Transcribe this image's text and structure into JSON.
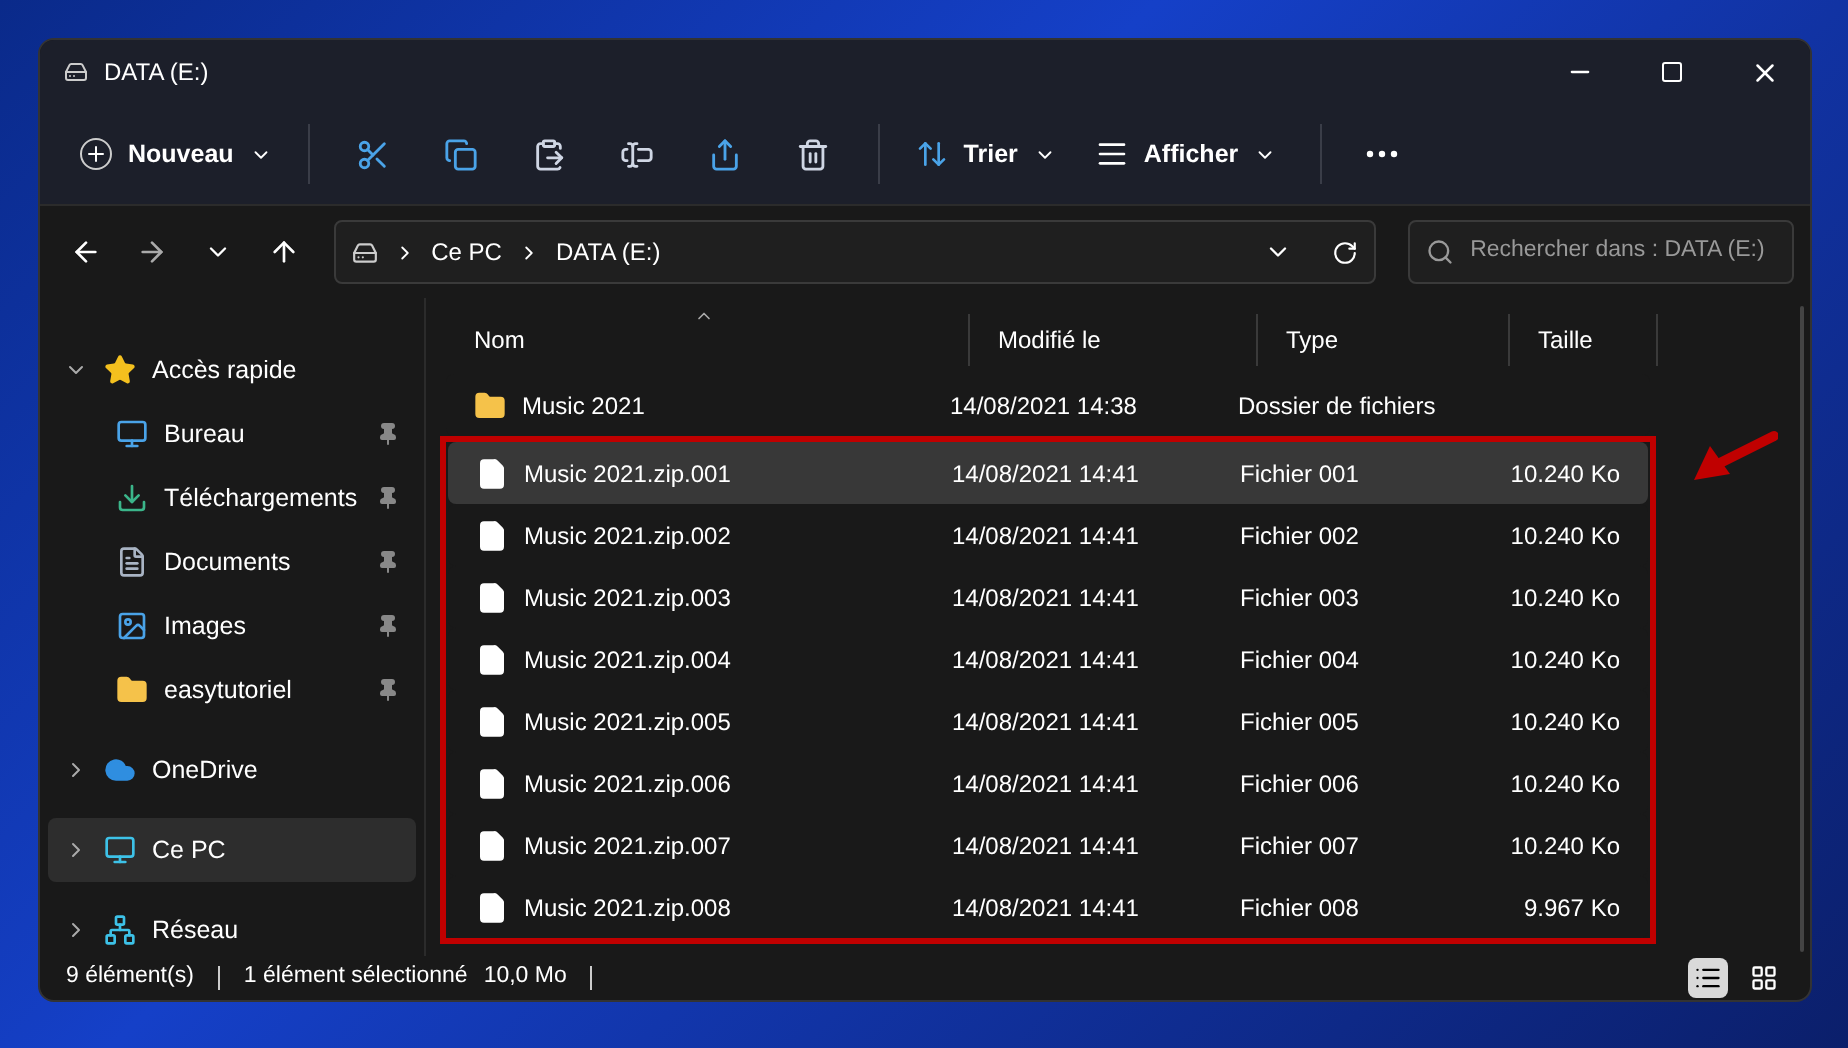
{
  "window": {
    "title": "DATA (E:)"
  },
  "toolbar": {
    "new_label": "Nouveau",
    "sort_label": "Trier",
    "view_label": "Afficher"
  },
  "address": {
    "crumbs": [
      "Ce PC",
      "DATA (E:)"
    ],
    "search_placeholder": "Rechercher dans : DATA (E:)"
  },
  "sidebar": {
    "items": [
      {
        "label": "Accès rapide",
        "kind": "star",
        "expanded": true,
        "selected": false,
        "children": [
          {
            "label": "Bureau",
            "kind": "desktop",
            "pinned": true
          },
          {
            "label": "Téléchargements",
            "kind": "download",
            "pinned": true
          },
          {
            "label": "Documents",
            "kind": "documents",
            "pinned": true
          },
          {
            "label": "Images",
            "kind": "images",
            "pinned": true
          },
          {
            "label": "easytutoriel",
            "kind": "folder",
            "pinned": true
          }
        ]
      },
      {
        "label": "OneDrive",
        "kind": "cloud",
        "expanded": false,
        "selected": false
      },
      {
        "label": "Ce PC",
        "kind": "pc",
        "expanded": false,
        "selected": true
      },
      {
        "label": "Réseau",
        "kind": "network",
        "expanded": false,
        "selected": false
      }
    ]
  },
  "table": {
    "columns": [
      "Nom",
      "Modifié le",
      "Type",
      "Taille"
    ],
    "rows": [
      {
        "kind": "folder",
        "name": "Music 2021",
        "modified": "14/08/2021 14:38",
        "type": "Dossier de fichiers",
        "size": "",
        "selected": false,
        "annotated": false
      },
      {
        "kind": "file",
        "name": "Music 2021.zip.001",
        "modified": "14/08/2021 14:41",
        "type": "Fichier 001",
        "size": "10.240 Ko",
        "selected": true,
        "annotated": true
      },
      {
        "kind": "file",
        "name": "Music 2021.zip.002",
        "modified": "14/08/2021 14:41",
        "type": "Fichier 002",
        "size": "10.240 Ko",
        "selected": false,
        "annotated": true
      },
      {
        "kind": "file",
        "name": "Music 2021.zip.003",
        "modified": "14/08/2021 14:41",
        "type": "Fichier 003",
        "size": "10.240 Ko",
        "selected": false,
        "annotated": true
      },
      {
        "kind": "file",
        "name": "Music 2021.zip.004",
        "modified": "14/08/2021 14:41",
        "type": "Fichier 004",
        "size": "10.240 Ko",
        "selected": false,
        "annotated": true
      },
      {
        "kind": "file",
        "name": "Music 2021.zip.005",
        "modified": "14/08/2021 14:41",
        "type": "Fichier 005",
        "size": "10.240 Ko",
        "selected": false,
        "annotated": true
      },
      {
        "kind": "file",
        "name": "Music 2021.zip.006",
        "modified": "14/08/2021 14:41",
        "type": "Fichier 006",
        "size": "10.240 Ko",
        "selected": false,
        "annotated": true
      },
      {
        "kind": "file",
        "name": "Music 2021.zip.007",
        "modified": "14/08/2021 14:41",
        "type": "Fichier 007",
        "size": "10.240 Ko",
        "selected": false,
        "annotated": true
      },
      {
        "kind": "file",
        "name": "Music 2021.zip.008",
        "modified": "14/08/2021 14:41",
        "type": "Fichier 008",
        "size": "9.967 Ko",
        "selected": false,
        "annotated": true
      }
    ]
  },
  "status_bar": {
    "count": "9 élément(s)",
    "selection": "1 élément sélectionné",
    "size": "10,0 Mo",
    "views": [
      {
        "kind": "details",
        "selected": true
      },
      {
        "kind": "tiles",
        "selected": false
      }
    ]
  }
}
